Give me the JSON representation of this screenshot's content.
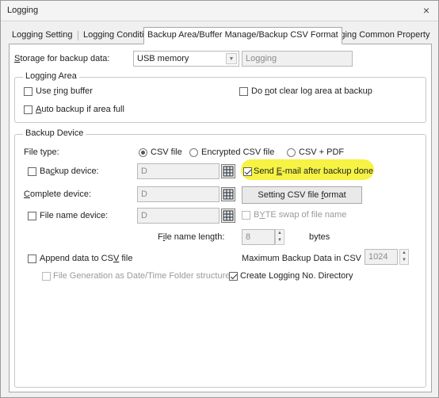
{
  "window": {
    "title": "Logging",
    "close_glyph": "×"
  },
  "tabs": [
    {
      "label": "Logging Setting"
    },
    {
      "label": "Logging Condition"
    },
    {
      "label": "Backup Area/Buffer Manage/Backup CSV Format"
    },
    {
      "label": "Logging Common Property"
    }
  ],
  "storage": {
    "label_pre": "",
    "label_u": "S",
    "label_post": "torage for backup data:",
    "selected": "USB memory",
    "folder_value": "Logging"
  },
  "logging_area": {
    "title": "Logging Area",
    "use_ring_buffer": {
      "pre": "Use ",
      "u": "r",
      "post": "ing buffer"
    },
    "do_not_clear": {
      "pre": "Do ",
      "u": "n",
      "post": "ot clear log area at backup"
    },
    "auto_backup": {
      "pre": "",
      "u": "A",
      "post": "uto backup if area full"
    }
  },
  "backup_device": {
    "title": "Backup Device",
    "file_type_label": "File type:",
    "file_type_options": [
      "CSV file",
      "Encrypted CSV file",
      "CSV + PDF"
    ],
    "backup_device": {
      "pre": "Ba",
      "u": "c",
      "post": "kup device:",
      "value": "D"
    },
    "send_email": {
      "pre": "Send ",
      "u": "E",
      "post": "-mail after backup done"
    },
    "complete_device": {
      "pre": "",
      "u": "C",
      "post": "omplete device:",
      "value": "D"
    },
    "setting_csv": {
      "pre": "Setting CSV file ",
      "u": "f",
      "post": "ormat"
    },
    "file_name_device": {
      "label": "File name device:",
      "value": "D"
    },
    "byte_swap": {
      "pre": "B",
      "u": "Y",
      "post": "TE swap of file name"
    },
    "file_name_length": {
      "pre": "F",
      "u": "i",
      "post": "le name length:",
      "value": "8",
      "unit": "bytes"
    },
    "append_csv": {
      "pre": "Append data to CS",
      "u": "V",
      "post": " file"
    },
    "max_backup": {
      "label": "Maximum Backup Data in CSV",
      "value": "1024"
    },
    "file_generation": {
      "label": "File Generation as Date/Time Folder structure"
    },
    "create_logging_dir": {
      "label": "Create Logging No. Directory"
    }
  },
  "icons": {
    "close": "close-icon",
    "dropdown": "chevron-down-icon",
    "device": "device-grid-icon",
    "spin_up": "spin-up-icon",
    "spin_down": "spin-down-icon"
  },
  "colors": {
    "highlight": "#f6f23a"
  }
}
